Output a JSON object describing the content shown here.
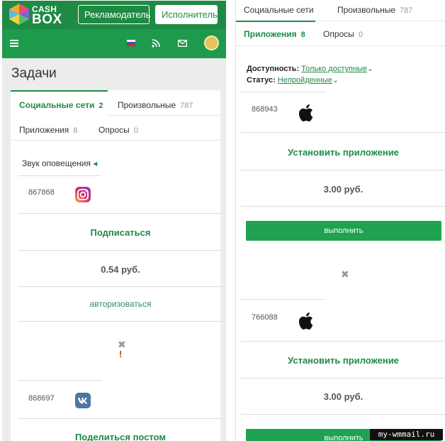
{
  "header": {
    "logo_line1": "CASH",
    "logo_line2": "BOX",
    "advertiser_button": "Рекламодатель",
    "executor_button": "Исполнитель"
  },
  "colors": {
    "brand_green": "#1f8a43",
    "subbar_green": "#1e9a4c",
    "button_green": "#1fa351"
  },
  "subbar": {
    "icons": [
      "menu-icon",
      "flag-ru-icon",
      "rss-icon",
      "mail-icon",
      "avatar"
    ]
  },
  "left": {
    "page_title": "Задачи",
    "tabs": [
      {
        "label": "Социальные сети",
        "count": "2",
        "active": true
      },
      {
        "label": "Произвольные",
        "count": "787",
        "active": false
      },
      {
        "label": "Приложения",
        "count": "8",
        "active": false
      },
      {
        "label": "Опросы",
        "count": "0",
        "active": false
      }
    ],
    "notify_label": "Звук оповещения",
    "notify_arrow": "◂",
    "tasks": [
      {
        "id": "867868",
        "icon": "instagram-icon",
        "action": "Подписаться",
        "price": "0.54 руб.",
        "link": "авторизоваться"
      },
      {
        "id": "868697",
        "icon": "vk-icon",
        "action": "Поделиться постом"
      }
    ],
    "x_mark": "✖",
    "exclamation": "!"
  },
  "right": {
    "tabs": [
      {
        "label": "Социальные сети",
        "count": "",
        "active": false
      },
      {
        "label": "Произвольные",
        "count": "787",
        "active": false
      },
      {
        "label": "Приложения",
        "count": "8",
        "active": true
      },
      {
        "label": "Опросы",
        "count": "0",
        "active": false
      }
    ],
    "availability_label": "Доступность:",
    "availability_value": "Только доступные",
    "status_label": "Статус:",
    "status_value": "Непройденные",
    "chevron": "⌄",
    "tasks": [
      {
        "id": "868943",
        "icon": "apple-icon",
        "action": "Установить приложение",
        "price": "3.00 руб.",
        "button": "выполнить"
      },
      {
        "id": "766088",
        "icon": "apple-icon",
        "action": "Установить приложение",
        "price": "3.00 руб.",
        "button": "выполнить"
      }
    ],
    "x_mark": "✖"
  },
  "watermark": "my-wmmail.ru"
}
